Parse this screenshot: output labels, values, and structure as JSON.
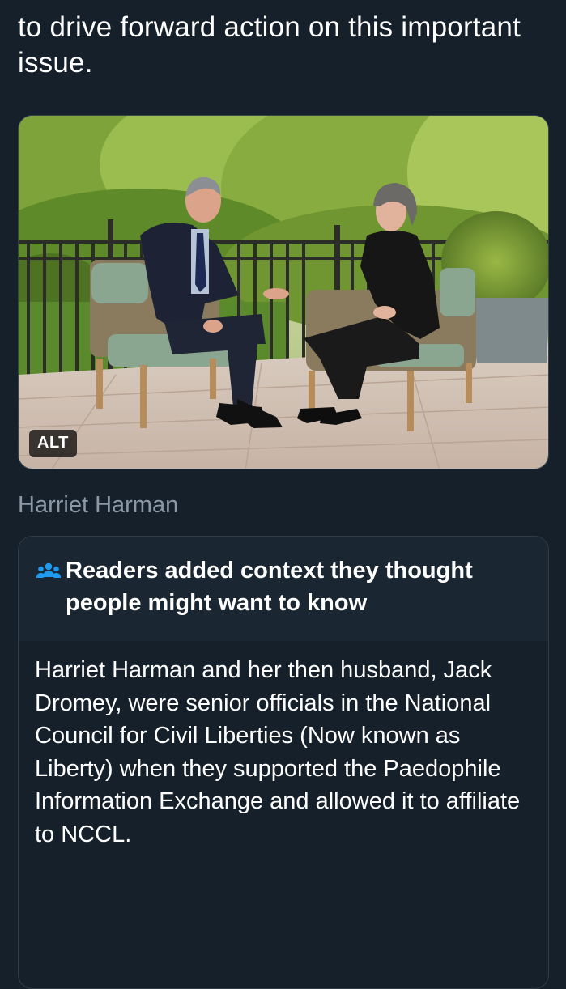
{
  "tweet": {
    "text": "to drive forward action on this important issue."
  },
  "media": {
    "alt_label": "ALT",
    "caption": "Harriet Harman"
  },
  "community_note": {
    "title": "Readers added context they thought people might want to know",
    "icon": "people-icon",
    "accent_color": "#1d9bf0",
    "body": "Harriet Harman and her then husband, Jack Dromey, were senior officials in the National Council for Civil Liberties (Now known as Liberty) when they supported the Paedophile Information Exchange and allowed it to affiliate to NCCL."
  }
}
